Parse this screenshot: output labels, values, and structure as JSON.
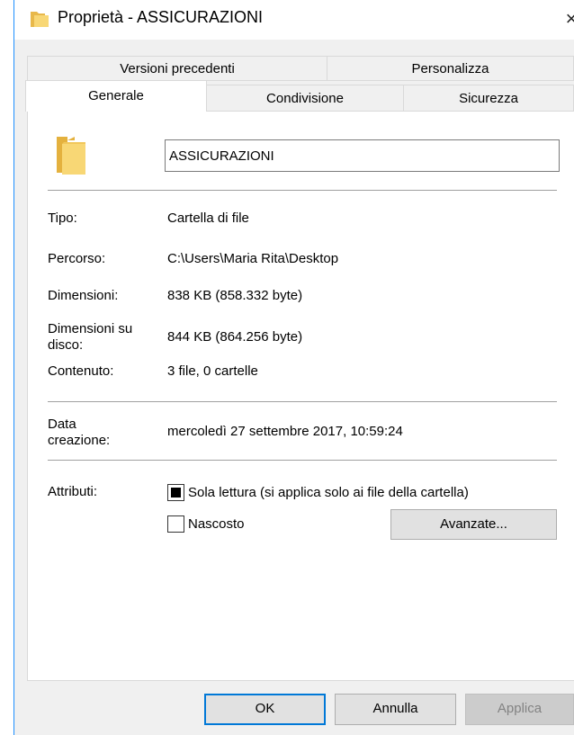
{
  "window": {
    "title": "Proprietà - ASSICURAZIONI",
    "close_glyph": "×",
    "title_icon": "folder-icon"
  },
  "tabs": {
    "row1": [
      "Versioni precedenti",
      "Personalizza"
    ],
    "row2": [
      "Generale",
      "Condivisione",
      "Sicurezza"
    ],
    "active": "Generale"
  },
  "general": {
    "folder_icon": "folder-icon",
    "name_value": "ASSICURAZIONI",
    "type_label": "Tipo:",
    "type_value": "Cartella di file",
    "path_label": "Percorso:",
    "path_value": "C:\\Users\\Maria Rita\\Desktop",
    "size_label": "Dimensioni:",
    "size_value": "838 KB (858.332 byte)",
    "disk_size_label_1": "Dimensioni su",
    "disk_size_label_2": "disco:",
    "disk_size_value": "844 KB (864.256 byte)",
    "contents_label": "Contenuto:",
    "contents_value": "3 file, 0 cartelle",
    "created_label_1": "Data",
    "created_label_2": "creazione:",
    "created_value": "mercoledì 27 settembre 2017, 10:59:24",
    "attributes_label": "Attributi:",
    "readonly_label": "Sola lettura (si applica solo ai file della cartella)",
    "readonly_state": "indeterminate",
    "hidden_label": "Nascosto",
    "hidden_state": "unchecked",
    "advanced_button": "Avanzate..."
  },
  "footer": {
    "ok": "OK",
    "cancel": "Annulla",
    "apply": "Applica"
  },
  "colors": {
    "accent": "#0078d7",
    "folder": "#f8d775",
    "dialog_bg": "#f0f0f0"
  }
}
